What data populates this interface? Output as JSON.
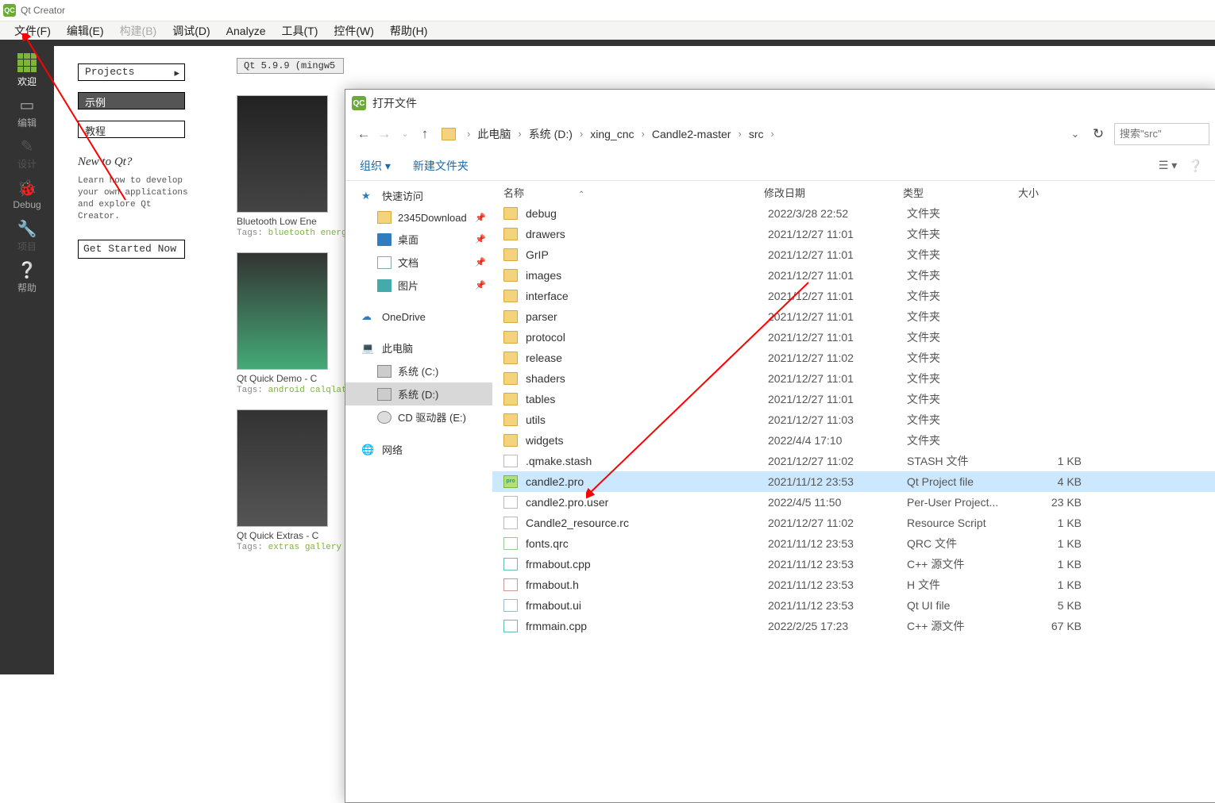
{
  "window": {
    "title": "Qt Creator"
  },
  "menubar": [
    {
      "label": "文件(F)",
      "enabled": true
    },
    {
      "label": "编辑(E)",
      "enabled": true
    },
    {
      "label": "构建(B)",
      "enabled": false
    },
    {
      "label": "调试(D)",
      "enabled": true
    },
    {
      "label": "Analyze",
      "enabled": true
    },
    {
      "label": "工具(T)",
      "enabled": true
    },
    {
      "label": "控件(W)",
      "enabled": true
    },
    {
      "label": "帮助(H)",
      "enabled": true
    }
  ],
  "rail": [
    {
      "label": "欢迎",
      "active": true
    },
    {
      "label": "编辑",
      "active": false
    },
    {
      "label": "设计",
      "active": false,
      "disabled": true
    },
    {
      "label": "Debug",
      "active": false
    },
    {
      "label": "项目",
      "active": false,
      "disabled": true
    },
    {
      "label": "帮助",
      "active": false
    }
  ],
  "nav": {
    "projects": "Projects",
    "examples": "示例",
    "tutorials": "教程"
  },
  "newqt": {
    "heading": "New to Qt?",
    "desc": "Learn how to develop your own applications and explore Qt Creator.",
    "button": "Get Started Now"
  },
  "kit": "Qt 5.9.9 (mingw5",
  "cards": [
    {
      "title": "Bluetooth Low Ene",
      "tags_label": "Tags:",
      "tags_text": "bluetooth energy low rate"
    },
    {
      "title": "Qt Quick Demo - C",
      "tags_label": "Tags:",
      "tags_text": "android calqlatr"
    },
    {
      "title": "Qt Quick Extras - C",
      "tags_label": "Tags:",
      "tags_text": "extras gallery qu"
    }
  ],
  "dialog": {
    "title": "打开文件",
    "crumbs": [
      "此电脑",
      "系统 (D:)",
      "xing_cnc",
      "Candle2-master",
      "src"
    ],
    "search_placeholder": "搜索\"src\"",
    "toolbar": {
      "organize": "组织",
      "newfolder": "新建文件夹"
    },
    "sidebar": [
      {
        "label": "快速访问",
        "kind": "star",
        "depth": 0
      },
      {
        "label": "2345Download",
        "kind": "folder",
        "depth": 1,
        "pinned": true
      },
      {
        "label": "桌面",
        "kind": "desktop",
        "depth": 1,
        "pinned": true
      },
      {
        "label": "文档",
        "kind": "doc",
        "depth": 1,
        "pinned": true
      },
      {
        "label": "图片",
        "kind": "pic",
        "depth": 1,
        "pinned": true
      },
      {
        "label": "OneDrive",
        "kind": "cloud",
        "depth": 0
      },
      {
        "label": "此电脑",
        "kind": "pc",
        "depth": 0
      },
      {
        "label": "系统 (C:)",
        "kind": "drive",
        "depth": 1
      },
      {
        "label": "系统 (D:)",
        "kind": "drive",
        "depth": 1,
        "selected": true
      },
      {
        "label": "CD 驱动器 (E:)",
        "kind": "cd",
        "depth": 1
      },
      {
        "label": "网络",
        "kind": "net",
        "depth": 0
      }
    ],
    "columns": {
      "name": "名称",
      "date": "修改日期",
      "type": "类型",
      "size": "大小"
    },
    "rows": [
      {
        "name": "debug",
        "date": "2022/3/28 22:52",
        "type": "文件夹",
        "size": "",
        "kind": "folder"
      },
      {
        "name": "drawers",
        "date": "2021/12/27 11:01",
        "type": "文件夹",
        "size": "",
        "kind": "folder"
      },
      {
        "name": "GrIP",
        "date": "2021/12/27 11:01",
        "type": "文件夹",
        "size": "",
        "kind": "folder"
      },
      {
        "name": "images",
        "date": "2021/12/27 11:01",
        "type": "文件夹",
        "size": "",
        "kind": "folder"
      },
      {
        "name": "interface",
        "date": "2021/12/27 11:01",
        "type": "文件夹",
        "size": "",
        "kind": "folder"
      },
      {
        "name": "parser",
        "date": "2021/12/27 11:01",
        "type": "文件夹",
        "size": "",
        "kind": "folder"
      },
      {
        "name": "protocol",
        "date": "2021/12/27 11:01",
        "type": "文件夹",
        "size": "",
        "kind": "folder"
      },
      {
        "name": "release",
        "date": "2021/12/27 11:02",
        "type": "文件夹",
        "size": "",
        "kind": "folder"
      },
      {
        "name": "shaders",
        "date": "2021/12/27 11:01",
        "type": "文件夹",
        "size": "",
        "kind": "folder"
      },
      {
        "name": "tables",
        "date": "2021/12/27 11:01",
        "type": "文件夹",
        "size": "",
        "kind": "folder"
      },
      {
        "name": "utils",
        "date": "2021/12/27 11:03",
        "type": "文件夹",
        "size": "",
        "kind": "folder"
      },
      {
        "name": "widgets",
        "date": "2022/4/4 17:10",
        "type": "文件夹",
        "size": "",
        "kind": "folder"
      },
      {
        "name": ".qmake.stash",
        "date": "2021/12/27 11:02",
        "type": "STASH 文件",
        "size": "1 KB",
        "kind": "file"
      },
      {
        "name": "candle2.pro",
        "date": "2021/11/12 23:53",
        "type": "Qt Project file",
        "size": "4 KB",
        "kind": "pro",
        "selected": true
      },
      {
        "name": "candle2.pro.user",
        "date": "2022/4/5 11:50",
        "type": "Per-User Project...",
        "size": "23 KB",
        "kind": "file"
      },
      {
        "name": "Candle2_resource.rc",
        "date": "2021/12/27 11:02",
        "type": "Resource Script",
        "size": "1 KB",
        "kind": "file"
      },
      {
        "name": "fonts.qrc",
        "date": "2021/11/12 23:53",
        "type": "QRC 文件",
        "size": "1 KB",
        "kind": "qrc"
      },
      {
        "name": "frmabout.cpp",
        "date": "2021/11/12 23:53",
        "type": "C++ 源文件",
        "size": "1 KB",
        "kind": "cpp"
      },
      {
        "name": "frmabout.h",
        "date": "2021/11/12 23:53",
        "type": "H 文件",
        "size": "1 KB",
        "kind": "h"
      },
      {
        "name": "frmabout.ui",
        "date": "2021/11/12 23:53",
        "type": "Qt UI file",
        "size": "5 KB",
        "kind": "ui"
      },
      {
        "name": "frmmain.cpp",
        "date": "2022/2/25 17:23",
        "type": "C++ 源文件",
        "size": "67 KB",
        "kind": "cpp"
      }
    ]
  }
}
